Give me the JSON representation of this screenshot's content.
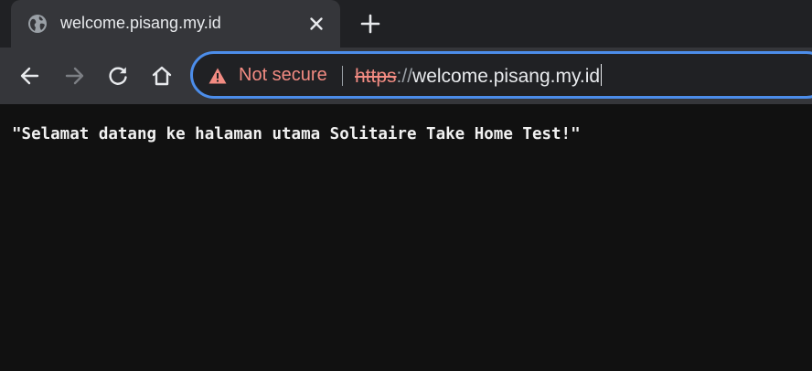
{
  "tab": {
    "title": "welcome.pisang.my.id",
    "favicon": "globe-icon",
    "close_icon": "close-icon"
  },
  "newtab": {
    "icon": "plus-icon"
  },
  "toolbar": {
    "back_icon": "back-arrow-icon",
    "forward_icon": "forward-arrow-icon",
    "reload_icon": "reload-icon",
    "home_icon": "home-icon"
  },
  "omnibox": {
    "security_icon": "warning-triangle-icon",
    "security_label": "Not secure",
    "url_scheme": "https",
    "url_separator": "://",
    "url_host": "welcome.pisang.my.id"
  },
  "page": {
    "message": "\"Selamat datang ke halaman utama Solitaire Take Home Test!\""
  },
  "colors": {
    "tabstrip_bg": "#202124",
    "toolbar_bg": "#35363a",
    "omnibox_border": "#4c8dea",
    "warning_red": "#f28b82",
    "page_bg": "#111111"
  }
}
